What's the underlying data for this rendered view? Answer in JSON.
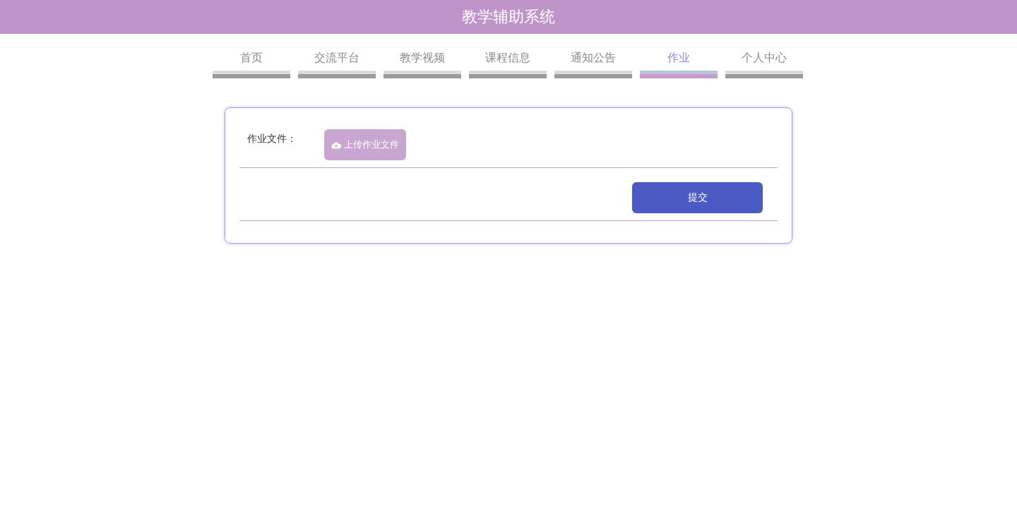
{
  "header": {
    "title": "教学辅助系统"
  },
  "tabs": [
    {
      "label": "首页",
      "selected": false
    },
    {
      "label": "交流平台",
      "selected": false
    },
    {
      "label": "教学视频",
      "selected": false
    },
    {
      "label": "课程信息",
      "selected": false
    },
    {
      "label": "通知公告",
      "selected": false
    },
    {
      "label": "作业",
      "selected": true
    },
    {
      "label": "个人中心",
      "selected": false
    }
  ],
  "form": {
    "file_label": "作业文件：",
    "upload_button": "上传作业文件",
    "submit_button": "提交"
  }
}
